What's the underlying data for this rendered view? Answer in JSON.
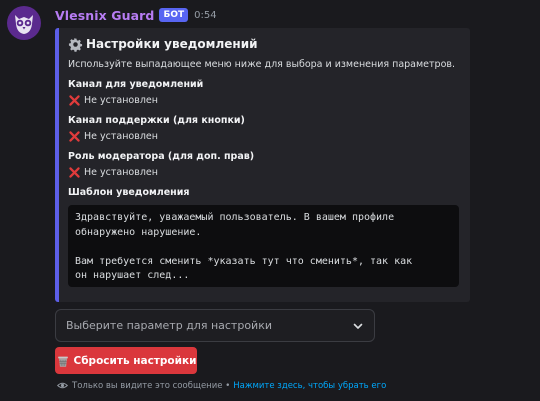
{
  "message": {
    "username": "Vlesnix Guard",
    "badge": "БОТ",
    "timestamp": "0:54"
  },
  "embed": {
    "accent_color": "#5c5ee8",
    "title_icon": "gear-icon",
    "title": "Настройки уведомлений",
    "description": "Используйте выпадающее меню ниже для выбора и изменения параметров.",
    "fields": [
      {
        "name": "Канал для уведомлений",
        "value_icon": "cross-mark-icon",
        "value": "Не установлен"
      },
      {
        "name": "Канал поддержки (для кнопки)",
        "value_icon": "cross-mark-icon",
        "value": "Не установлен"
      },
      {
        "name": "Роль модератора (для доп. прав)",
        "value_icon": "cross-mark-icon",
        "value": "Не установлен"
      },
      {
        "name": "Шаблон уведомления"
      }
    ],
    "template_lines": [
      "Здравствуйте, уважаемый пользователь. В вашем профиле",
      "обнаружено нарушение.",
      "",
      "Вам требуется сменить *указать тут что сменить*, так как",
      "он нарушает след..."
    ]
  },
  "select_menu": {
    "placeholder": "Выберите параметр для настройки",
    "icon": "chevron-down-icon"
  },
  "reset_button": {
    "icon": "wastebasket-icon",
    "label": "Сбросить настройки",
    "color": "#da373c"
  },
  "ephemeral_note": {
    "icon": "eye-icon",
    "text": "Только вы видите это сообщение •",
    "link": "Нажмите здесь, чтобы убрать его"
  }
}
